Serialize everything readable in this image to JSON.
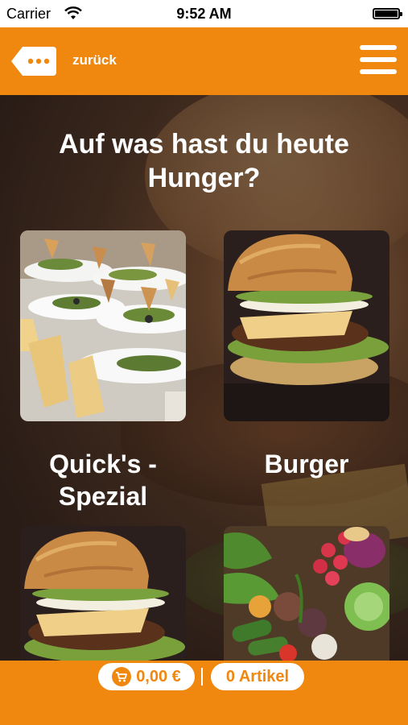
{
  "status_bar": {
    "carrier": "Carrier",
    "time": "9:52 AM"
  },
  "nav": {
    "back_label": "zurück"
  },
  "heading": "Auf was hast du heute Hunger?",
  "categories": [
    {
      "label": "Quick's - Spezial",
      "image": "appetizer-plates"
    },
    {
      "label": "Burger",
      "image": "burger"
    },
    {
      "label": "",
      "image": "burger"
    },
    {
      "label": "",
      "image": "vegetables"
    }
  ],
  "cart": {
    "total": "0,00 €",
    "items": "0 Artikel",
    "separator": "|"
  },
  "colors": {
    "accent": "#f0870e",
    "text_light": "#ffffff"
  }
}
